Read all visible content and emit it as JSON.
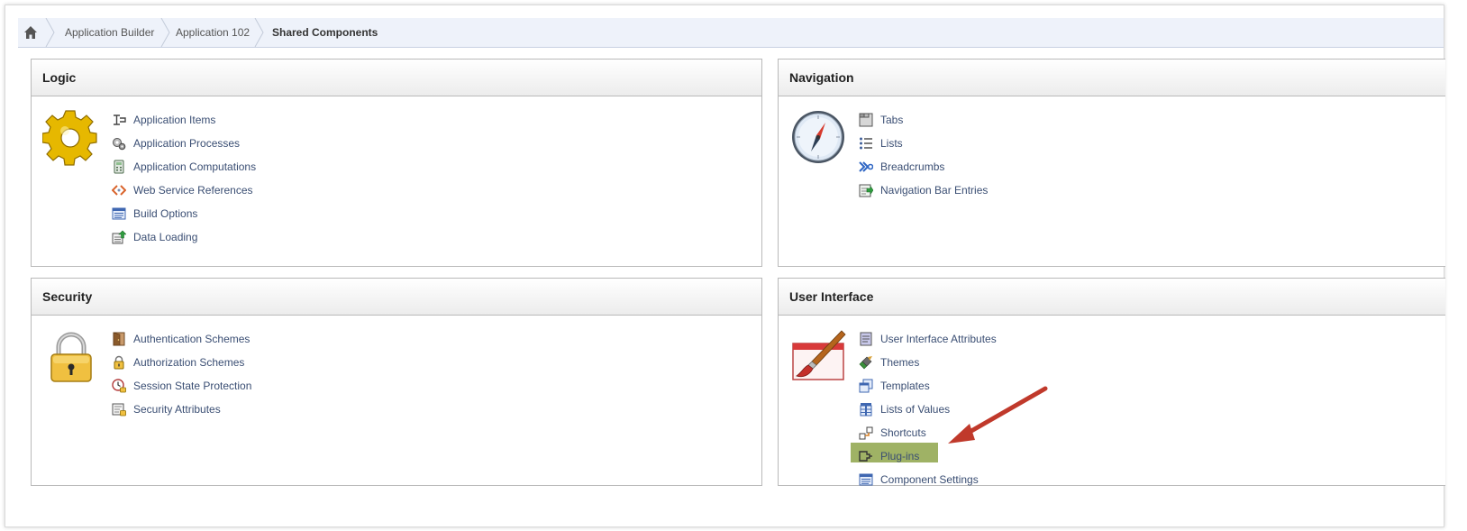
{
  "breadcrumb": {
    "home_icon": "home-icon",
    "items": [
      "Application Builder",
      "Application 102",
      "Shared Components"
    ]
  },
  "panels": {
    "logic": {
      "title": "Logic",
      "big_icon": "gear-icon",
      "links": [
        {
          "label": "Application Items",
          "icon": "application-items-icon"
        },
        {
          "label": "Application Processes",
          "icon": "gears-icon"
        },
        {
          "label": "Application Computations",
          "icon": "calculator-icon"
        },
        {
          "label": "Web Service References",
          "icon": "web-service-icon"
        },
        {
          "label": "Build Options",
          "icon": "build-options-icon"
        },
        {
          "label": "Data Loading",
          "icon": "data-loading-icon"
        }
      ]
    },
    "navigation": {
      "title": "Navigation",
      "big_icon": "compass-icon",
      "links": [
        {
          "label": "Tabs",
          "icon": "tabs-icon"
        },
        {
          "label": "Lists",
          "icon": "list-icon"
        },
        {
          "label": "Breadcrumbs",
          "icon": "breadcrumbs-icon"
        },
        {
          "label": "Navigation Bar Entries",
          "icon": "navigation-bar-icon"
        }
      ]
    },
    "security": {
      "title": "Security",
      "big_icon": "padlock-icon",
      "links": [
        {
          "label": "Authentication Schemes",
          "icon": "door-icon"
        },
        {
          "label": "Authorization Schemes",
          "icon": "lock-icon"
        },
        {
          "label": "Session State Protection",
          "icon": "session-clock-icon"
        },
        {
          "label": "Security Attributes",
          "icon": "security-attributes-icon"
        }
      ]
    },
    "ui": {
      "title": "User Interface",
      "big_icon": "paintbrush-icon",
      "links": [
        {
          "label": "User Interface Attributes",
          "icon": "ui-attributes-icon"
        },
        {
          "label": "Themes",
          "icon": "themes-icon"
        },
        {
          "label": "Templates",
          "icon": "templates-icon"
        },
        {
          "label": "Lists of Values",
          "icon": "lov-icon"
        },
        {
          "label": "Shortcuts",
          "icon": "shortcuts-icon"
        },
        {
          "label": "Plug-ins",
          "icon": "plugin-icon",
          "highlighted": true
        },
        {
          "label": "Component Settings",
          "icon": "component-settings-icon"
        }
      ]
    }
  },
  "annotation": {
    "icon": "red-arrow-icon",
    "color": "#c0392b",
    "highlight_color": "#9fb265"
  },
  "colors": {
    "link": "#3a4e73",
    "breadcrumb_bg": "#eef2fa"
  }
}
